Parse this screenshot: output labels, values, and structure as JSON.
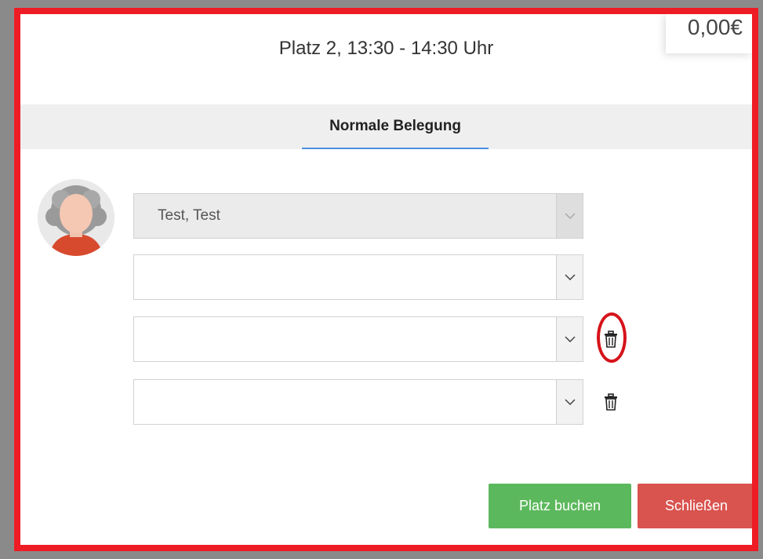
{
  "dialog": {
    "title": "Platz 2, 13:30 - 14:30 Uhr",
    "price": "0,00€"
  },
  "tabs": [
    {
      "label": "Normale Belegung",
      "active": true
    }
  ],
  "players": [
    {
      "value": "Test, Test",
      "disabled": true,
      "deletable": false
    },
    {
      "value": "",
      "disabled": false,
      "deletable": false
    },
    {
      "value": "",
      "disabled": false,
      "deletable": true,
      "highlighted": true
    },
    {
      "value": "",
      "disabled": false,
      "deletable": true
    }
  ],
  "buttons": {
    "book_label": "Platz buchen",
    "close_label": "Schließen"
  },
  "colors": {
    "highlight_border": "#ee1c25",
    "tab_underline": "#4a90e2",
    "book_button": "#5cb85c",
    "close_button": "#d9534f"
  },
  "icons": {
    "avatar": "user-avatar-icon",
    "dropdown": "chevron-down-icon",
    "delete": "trash-icon"
  }
}
